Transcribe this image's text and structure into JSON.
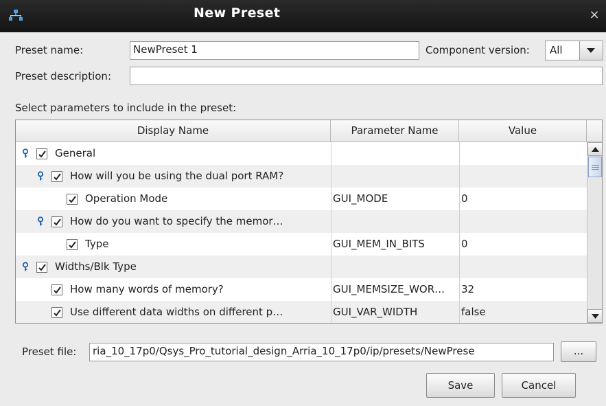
{
  "window": {
    "title": "New Preset",
    "close_glyph": "×",
    "app_icon": "network-icon"
  },
  "preset_name": {
    "label": "Preset name:",
    "value": "NewPreset 1"
  },
  "component_version": {
    "label": "Component version:",
    "value": "All"
  },
  "preset_description": {
    "label": "Preset description:",
    "value": ""
  },
  "parameters": {
    "instruction": "Select parameters to include in the preset:",
    "columns": [
      "Display Name",
      "Parameter Name",
      "Value"
    ],
    "rows": [
      {
        "display": "General",
        "param": "",
        "value": "",
        "level": 0,
        "group": true,
        "checked": true
      },
      {
        "display": "How will you be using the dual port RAM?",
        "param": "",
        "value": "",
        "level": 1,
        "group": true,
        "checked": true
      },
      {
        "display": "Operation Mode",
        "param": "GUI_MODE",
        "value": "0",
        "level": 2,
        "group": false,
        "checked": true
      },
      {
        "display": "How do you want to specify the memor…",
        "param": "",
        "value": "",
        "level": 1,
        "group": true,
        "checked": true
      },
      {
        "display": "Type",
        "param": "GUI_MEM_IN_BITS",
        "value": "0",
        "level": 2,
        "group": false,
        "checked": true
      },
      {
        "display": "Widths/Blk Type",
        "param": "",
        "value": "",
        "level": 0,
        "group": true,
        "checked": true
      },
      {
        "display": "How many words of memory?",
        "param": "GUI_MEMSIZE_WOR…",
        "value": "32",
        "level": 1,
        "group": false,
        "checked": true
      },
      {
        "display": "Use different data widths on different p…",
        "param": "GUI_VAR_WIDTH",
        "value": "false",
        "level": 1,
        "group": false,
        "checked": true
      }
    ]
  },
  "preset_file": {
    "label": "Preset file:",
    "value": "ria_10_17p0/Qsys_Pro_tutorial_design_Arria_10_17p0/ip/presets/NewPrese",
    "browse_label": "..."
  },
  "buttons": {
    "save": "Save",
    "cancel": "Cancel"
  }
}
